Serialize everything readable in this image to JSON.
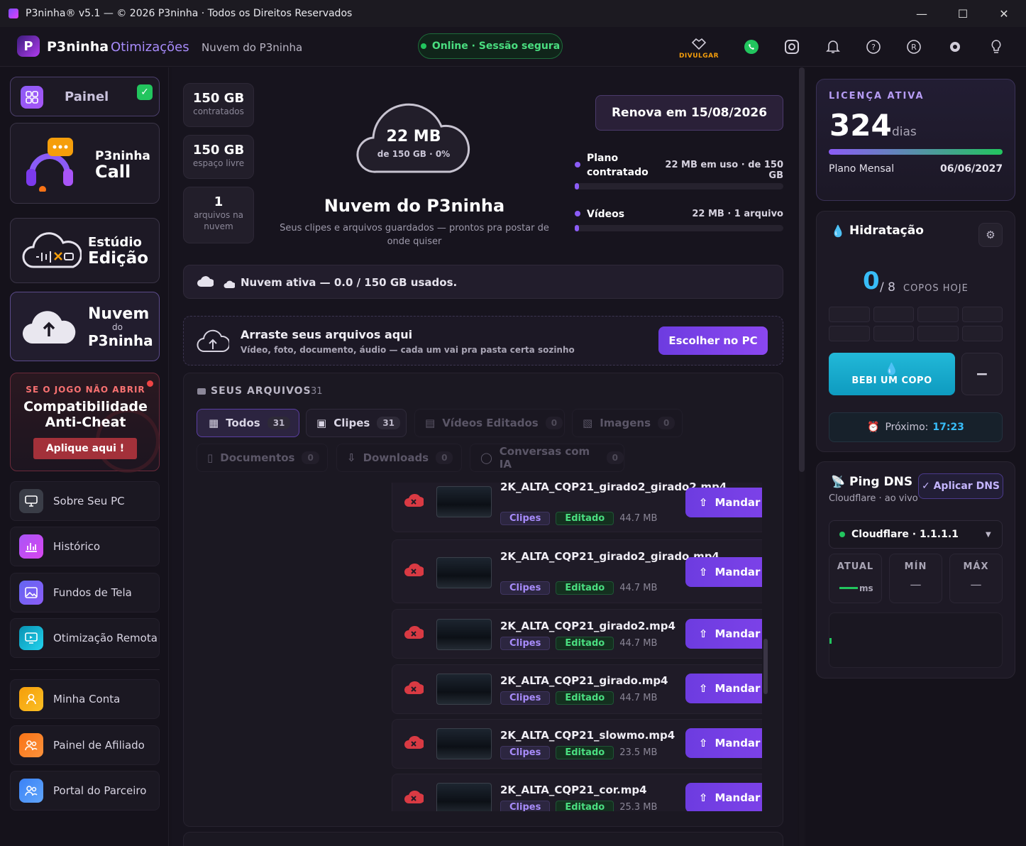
{
  "titlebar": {
    "title": "P3ninha® v5.1 — © 2026 P3ninha · Todos os Direitos Reservados"
  },
  "header": {
    "brand": "P3ninha",
    "brand_sub": "Otimizações",
    "nav": "Nuvem do P3ninha",
    "status": "Online · Sessão segura",
    "divulgar": "DIVULGAR"
  },
  "sidebar": {
    "painel": "Painel",
    "call": {
      "line1": "P3ninha",
      "line2": "Call"
    },
    "estudio": {
      "line1": "Estúdio",
      "line2": "Edição"
    },
    "nuvem": {
      "line1": "Nuvem",
      "line2": "do",
      "line3": "P3ninha"
    },
    "anticheat": {
      "kicker": "SE O JOGO NÃO ABRIR",
      "line1": "Compatibilidade",
      "line2": "Anti-Cheat",
      "cta": "Aplique aqui !"
    },
    "items": [
      {
        "label": "Sobre Seu PC"
      },
      {
        "label": "Histórico"
      },
      {
        "label": "Fundos de Tela"
      },
      {
        "label": "Otimização Remota"
      },
      {
        "label": "Minha Conta"
      },
      {
        "label": "Painel de Afiliado"
      },
      {
        "label": "Portal do Parceiro"
      }
    ]
  },
  "stats": [
    {
      "value": "150 GB",
      "label": "contratados"
    },
    {
      "value": "150 GB",
      "label": "espaço livre"
    },
    {
      "value": "1",
      "label": "arquivos na nuvem"
    }
  ],
  "cloud": {
    "used": "22 MB",
    "sub": "de 150 GB · 0%",
    "title": "Nuvem do P3ninha",
    "desc": "Seus clipes e arquivos guardados — prontos pra postar de onde quiser",
    "renew": "Renova em 15/08/2026",
    "plan_label": "Plano contratado",
    "plan_value": "22 MB em uso · de 150 GB",
    "videos_label": "Vídeos",
    "videos_value": "22 MB · 1 arquivo",
    "active_bar": "Nuvem ativa — 0.0 / 150 GB usados."
  },
  "upload": {
    "title": "Arraste seus arquivos aqui",
    "desc": "Vídeo, foto, documento, áudio — cada um vai pra pasta certa sozinho",
    "button": "Escolher no PC"
  },
  "files": {
    "header": "SEUS ARQUIVOS",
    "count": "31",
    "tabs": [
      {
        "label": "Todos",
        "count": "31"
      },
      {
        "label": "Clipes",
        "count": "31"
      },
      {
        "label": "Vídeos Editados",
        "count": "0"
      },
      {
        "label": "Imagens",
        "count": "0"
      },
      {
        "label": "Documentos",
        "count": "0"
      },
      {
        "label": "Downloads",
        "count": "0"
      },
      {
        "label": "Conversas com IA",
        "count": "0"
      }
    ],
    "rows": [
      {
        "name": "2K_ALTA_CQP21_girado2_girado2.mp4",
        "tag1": "Clipes",
        "tag2": "Editado",
        "size": "44.7 MB",
        "action": "Mandar pra nuvem"
      },
      {
        "name": "2K_ALTA_CQP21_girado2_girado.mp4",
        "tag1": "Clipes",
        "tag2": "Editado",
        "size": "44.7 MB",
        "action": "Mandar pra nuvem"
      },
      {
        "name": "2K_ALTA_CQP21_girado2.mp4",
        "tag1": "Clipes",
        "tag2": "Editado",
        "size": "44.7 MB",
        "action": "Mandar pra nuvem"
      },
      {
        "name": "2K_ALTA_CQP21_girado.mp4",
        "tag1": "Clipes",
        "tag2": "Editado",
        "size": "44.7 MB",
        "action": "Mandar pra nuvem"
      },
      {
        "name": "2K_ALTA_CQP21_slowmo.mp4",
        "tag1": "Clipes",
        "tag2": "Editado",
        "size": "23.5 MB",
        "action": "Mandar pra nuvem"
      },
      {
        "name": "2K_ALTA_CQP21_cor.mp4",
        "tag1": "Clipes",
        "tag2": "Editado",
        "size": "25.3 MB",
        "action": "Mandar pra nuvem"
      }
    ]
  },
  "license": {
    "kicker": "LICENÇA ATIVA",
    "days": "324",
    "days_unit": "dias",
    "plan": "Plano Mensal",
    "expires": "06/06/2027"
  },
  "hydration": {
    "title": "Hidratação",
    "count": "0",
    "goal": "/ 8",
    "goal_label": "COPOS HOJE",
    "drink": "BEBI UM COPO",
    "minus": "−",
    "next_label": "Próximo:",
    "next_time": "17:23"
  },
  "ping": {
    "title": "Ping DNS",
    "sub": "Cloudflare · ao vivo",
    "apply": "✓ Aplicar DNS",
    "server": "Cloudflare · 1.1.1.1",
    "atual": "ATUAL",
    "atual_unit": "ms",
    "min": "MÍN",
    "max": "MÁX",
    "dash": "—"
  },
  "colors": {
    "accent": "#8b47f0",
    "green": "#22c55e",
    "bg": "#16131c"
  }
}
